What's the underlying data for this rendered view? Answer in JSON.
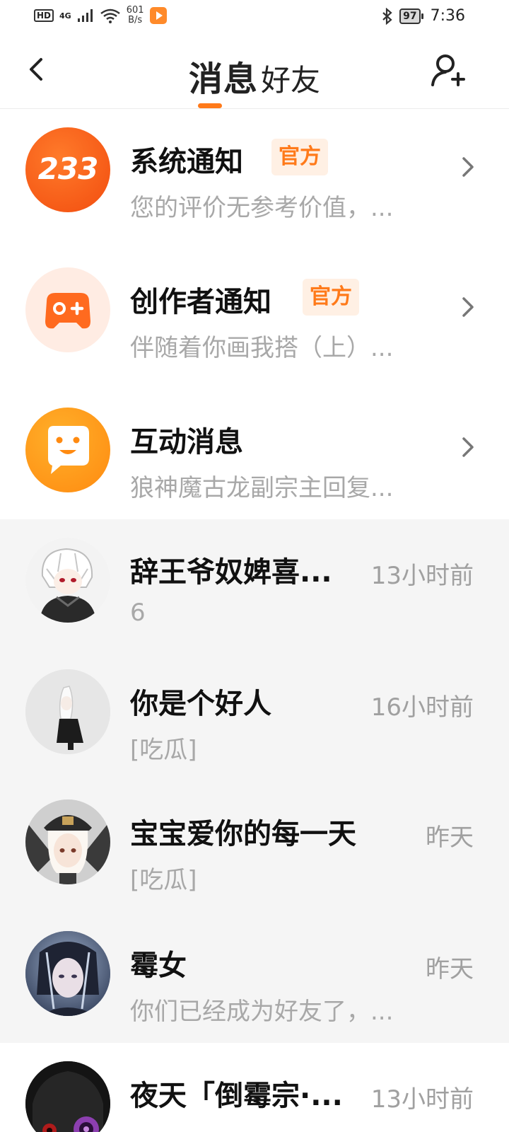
{
  "status_bar": {
    "hd": "HD",
    "network": "4G",
    "speed_value": "601",
    "speed_unit": "B/s",
    "battery": "97",
    "time": "7:36"
  },
  "header": {
    "tab_messages": "消息",
    "tab_friends": "好友",
    "accent_color": "#ff7a1a"
  },
  "notices": [
    {
      "title": "系统通知",
      "badge": "官方",
      "subtitle": "您的评价无参考价值，...",
      "avatar_text": "233",
      "avatar_icon": "233-logo-icon"
    },
    {
      "title": "创作者通知",
      "badge": "官方",
      "subtitle": "伴随着你画我搭（上）...",
      "avatar_icon": "gamepad-icon"
    },
    {
      "title": "互动消息",
      "badge": "",
      "subtitle": "狼神魔古龙副宗主回复...",
      "avatar_icon": "smile-chat-icon"
    }
  ],
  "chats": [
    {
      "name": "辞王爷奴婢喜...",
      "time": "13小时前",
      "preview": "6"
    },
    {
      "name": "你是个好人",
      "time": "16小时前",
      "preview": "[吃瓜]"
    },
    {
      "name": "宝宝爱你的每一天",
      "time": "昨天",
      "preview": "[吃瓜]"
    },
    {
      "name": "霉女",
      "time": "昨天",
      "preview": "你们已经成为好友了，..."
    },
    {
      "name": "夜天「倒霉宗·...",
      "time": "13小时前",
      "preview": ""
    }
  ]
}
